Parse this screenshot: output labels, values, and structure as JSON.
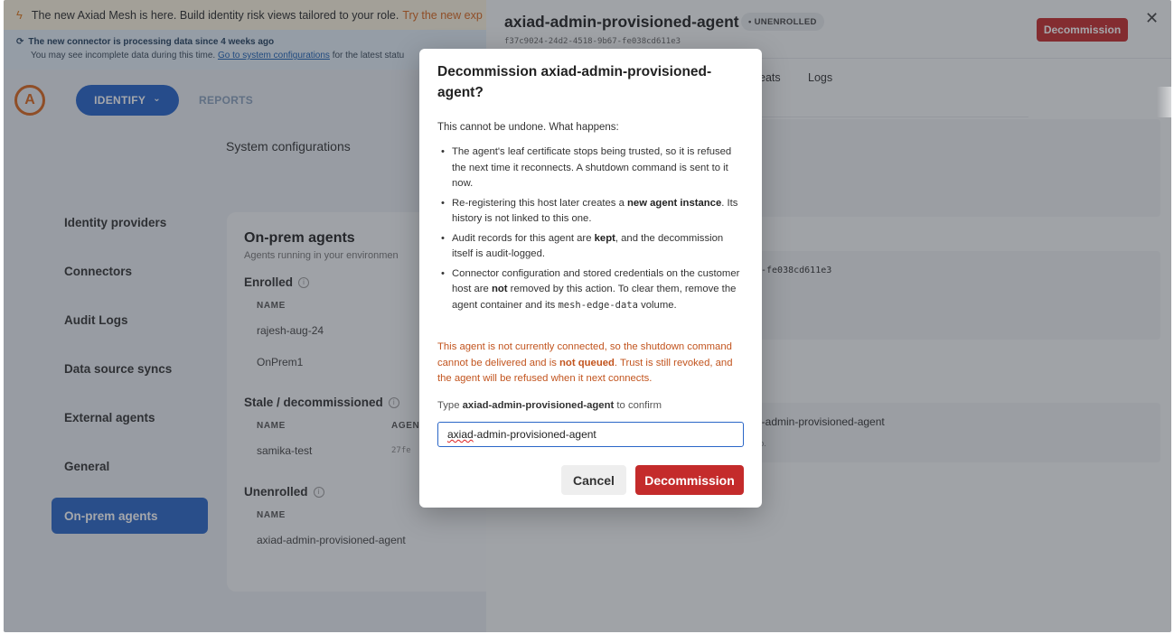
{
  "announcement": {
    "text": "The new Axiad Mesh is here. Build identity risk views tailored to your role.",
    "link": "Try the new exp"
  },
  "info_banner": {
    "line1": "The new connector is processing data since 4 weeks ago",
    "line2_prefix": "You may see incomplete data during this time.",
    "line2_link": "Go to system configurations",
    "line2_suffix": "for the latest statu"
  },
  "nav": {
    "logo_letter": "A",
    "identify": "IDENTIFY",
    "identify_chevron": "⌄",
    "reports": "REPORTS",
    "page_title": "System configurations"
  },
  "sidebar": {
    "items": [
      {
        "label": "Identity providers"
      },
      {
        "label": "Connectors"
      },
      {
        "label": "Audit Logs"
      },
      {
        "label": "Data source syncs"
      },
      {
        "label": "External agents"
      },
      {
        "label": "General"
      },
      {
        "label": "On-prem agents"
      }
    ]
  },
  "agents_card": {
    "title": "On-prem agents",
    "subtitle": "Agents running in your environmen",
    "enrolled": {
      "label": "Enrolled",
      "column": "NAME",
      "rows": [
        "rajesh-aug-24",
        "OnPrem1"
      ]
    },
    "stale": {
      "label": "Stale / decommissioned",
      "columns": [
        "NAME",
        "AGEN"
      ],
      "rows": [
        {
          "name": "samika-test",
          "id": "27fe"
        }
      ]
    },
    "unenrolled": {
      "label": "Unenrolled",
      "column": "NAME",
      "rows": [
        "axiad-admin-provisioned-agent"
      ]
    }
  },
  "drawer": {
    "title": "axiad-admin-provisioned-agent",
    "badge": "UNENROLLED",
    "uuid": "f37c9024-24d2-4518-9b67-fe038cd611e3",
    "decommission_button": "Decommission",
    "close": "✕",
    "tabs": [
      "eats",
      "Logs"
    ],
    "uuid_fragment": "-fe038cd611e3",
    "name_fragment": "l-admin-provisioned-agent",
    "sub_fragment": "b."
  },
  "modal": {
    "title": "Decommission axiad-admin-provisioned-agent?",
    "lead": "This cannot be undone. What happens:",
    "bullets": [
      {
        "p1": "The agent's leaf certificate stops being trusted, so it is refused the next time it reconnects. A shutdown command is sent to it now."
      },
      {
        "p1": "Re-registering this host later creates a ",
        "b1": "new agent instance",
        "p2": ". Its history is not linked to this one."
      },
      {
        "p1": "Audit records for this agent are ",
        "b1": "kept",
        "p2": ", and the decommission itself is audit-logged."
      },
      {
        "p1": "Connector configuration and stored credentials on the customer host are ",
        "b1": "not",
        "p2": " removed by this action. To clear them, remove the agent container and its ",
        "code": "mesh-edge-data",
        "p3": " volume."
      }
    ],
    "warning": {
      "p1": "This agent is not currently connected, so the shutdown command cannot be delivered and is ",
      "b1": "not queued",
      "p2": ". Trust is still revoked, and the agent will be refused when it next connects."
    },
    "confirm_label": {
      "p1": "Type ",
      "b1": "axiad-admin-provisioned-agent",
      "p2": " to confirm"
    },
    "input": {
      "value_flagged": "axiad",
      "value_rest": "-admin-provisioned-agent"
    },
    "cancel": "Cancel",
    "confirm": "Decommission"
  },
  "colors": {
    "accent": "#2563c9",
    "danger": "#c42b2b",
    "warning_text": "#c2541e",
    "brand_orange": "#d9661c"
  }
}
